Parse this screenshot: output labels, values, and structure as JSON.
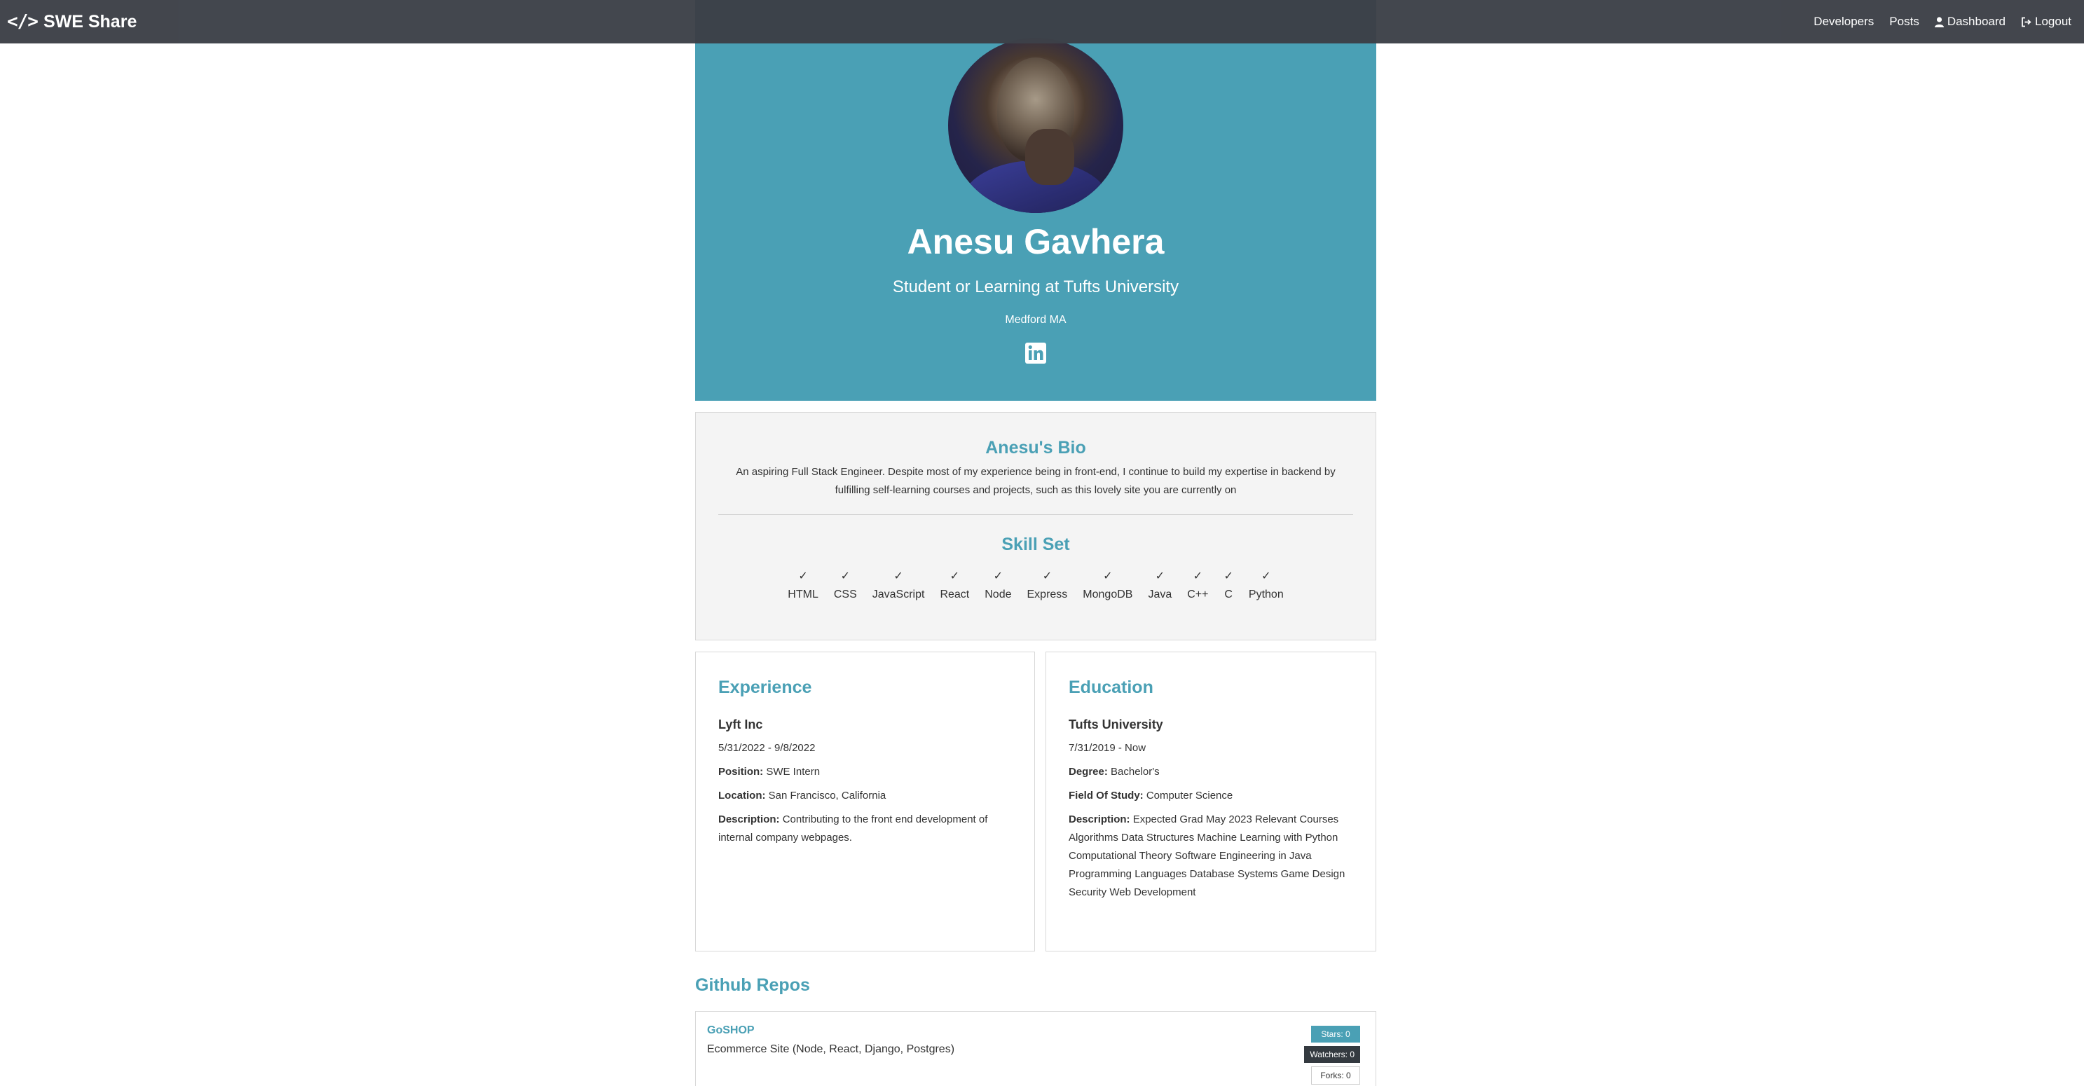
{
  "navbar": {
    "brand_icon": "</>",
    "brand": "SWE Share",
    "links": {
      "developers": "Developers",
      "posts": "Posts",
      "dashboard": "Dashboard",
      "logout": "Logout"
    }
  },
  "profile": {
    "name": "Anesu Gavhera",
    "status": "Student or Learning at Tufts University",
    "location": "Medford MA",
    "social_icon": "linkedin-icon"
  },
  "bio": {
    "title": "Anesu's Bio",
    "text": "An aspiring Full Stack Engineer. Despite most of my experience being in front-end, I continue to build my expertise in backend by fulfilling self-learning courses and projects, such as this lovely site you are currently on"
  },
  "skills": {
    "title": "Skill Set",
    "check": "✓",
    "items": [
      "HTML",
      "CSS",
      "JavaScript",
      "React",
      "Node",
      "Express",
      "MongoDB",
      "Java",
      "C++",
      "C",
      "Python"
    ]
  },
  "experience": {
    "title": "Experience",
    "company": "Lyft Inc",
    "dates": "5/31/2022 - 9/8/2022",
    "position_label": "Position:",
    "position": "SWE Intern",
    "location_label": "Location:",
    "location": "San Francisco, California",
    "description_label": "Description:",
    "description": "Contributing to the front end development of internal company webpages."
  },
  "education": {
    "title": "Education",
    "school": "Tufts University",
    "dates": "7/31/2019 - Now",
    "degree_label": "Degree:",
    "degree": "Bachelor's",
    "field_label": "Field Of Study:",
    "field": "Computer Science",
    "description_label": "Description:",
    "description": "Expected Grad May 2023 Relevant Courses Algorithms Data Structures Machine Learning with Python Computational Theory Software Engineering in Java Programming Languages Database Systems Game Design Security Web Development"
  },
  "github": {
    "title": "Github Repos",
    "repos": [
      {
        "name": "GoSHOP",
        "description": "Ecommerce Site (Node, React, Django, Postgres)",
        "stars": "Stars: 0",
        "watchers": "Watchers: 0",
        "forks": "Forks: 0"
      }
    ]
  },
  "colors": {
    "navbar": "#3d4148",
    "accent": "#4aa0b5",
    "bio_bg": "#f4f4f4"
  }
}
